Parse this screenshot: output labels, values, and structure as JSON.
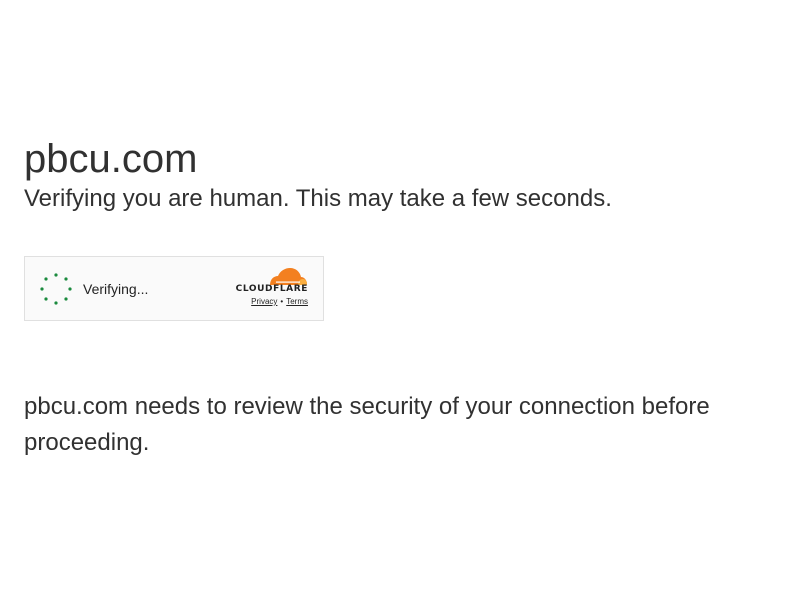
{
  "page": {
    "site_title": "pbcu.com",
    "subtitle": "Verifying you are human. This may take a few seconds.",
    "security_message": "pbcu.com needs to review the security of your connection before proceeding."
  },
  "challenge_widget": {
    "status_label": "Verifying...",
    "brand_name": "CLOUDFLARE",
    "privacy_label": "Privacy",
    "separator": "•",
    "terms_label": "Terms",
    "spinner_icon": "loading-spinner-icon",
    "logo_icon": "cloudflare-cloud-icon",
    "colors": {
      "spinner": "#1b8a3e",
      "cloud_orange": "#f38020",
      "cloud_light": "#faae40"
    }
  }
}
